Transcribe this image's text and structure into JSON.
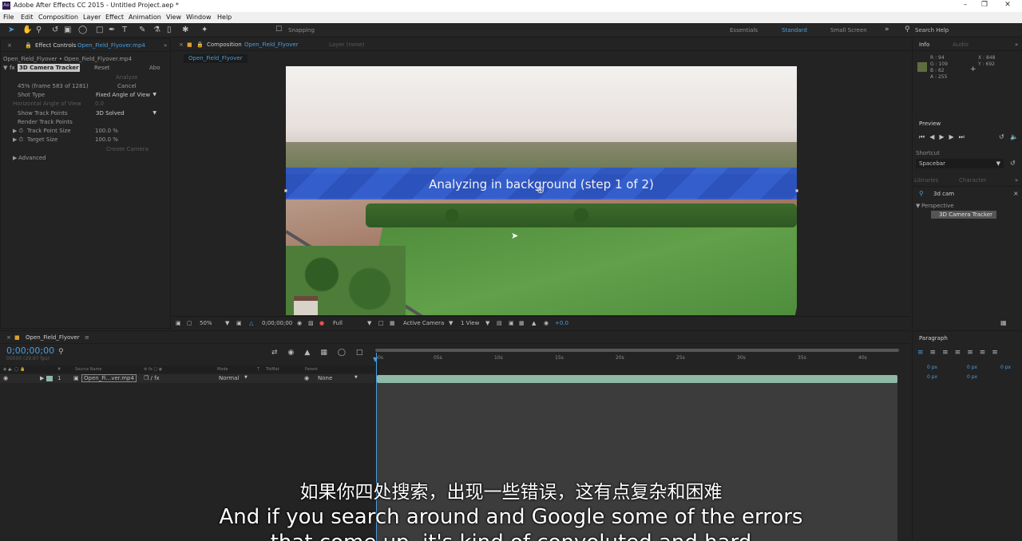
{
  "window": {
    "title": "Adobe After Effects CC 2015 - Untitled Project.aep *",
    "logo": "Ae"
  },
  "menu": [
    "File",
    "Edit",
    "Composition",
    "Layer",
    "Effect",
    "Animation",
    "View",
    "Window",
    "Help"
  ],
  "toolbar": {
    "snapping_label": "Snapping",
    "workspaces": [
      "Essentials",
      "Standard",
      "Small Screen"
    ],
    "search_placeholder": "Search Help"
  },
  "effect_controls": {
    "panel_label": "Effect Controls",
    "panel_file": "Open_Field_Flyover.mp4",
    "breadcrumb": "Open_Field_Flyover • Open_Field_Flyover.mp4",
    "effect_name": "3D Camera Tracker",
    "reset_label": "Reset",
    "about_label": "Abo",
    "analyze_label": "Analyze",
    "status_text": "45% (frame 583 of 1281)",
    "cancel_label": "Cancel",
    "shot_type_label": "Shot Type",
    "shot_type_value": "Fixed Angle of View",
    "horizontal_angle_label": "Horizontal Angle of View",
    "horizontal_angle_value": "0.0",
    "show_track_points_label": "Show Track Points",
    "show_track_points_value": "3D Solved",
    "render_track_points_label": "Render Track Points",
    "track_point_size_label": "Track Point Size",
    "track_point_size_value": "100.0 %",
    "target_size_label": "Target Size",
    "target_size_value": "100.0 %",
    "create_camera_label": "Create Camera",
    "advanced_label": "Advanced"
  },
  "composition": {
    "panel_label": "Composition",
    "comp_name": "Open_Field_Flyover",
    "layer_label": "Layer (none)",
    "tab_label": "Open_Field_Flyover",
    "banner_text": "Analyzing in background (step 1 of 2)",
    "zoom": "50%",
    "timecode": "0;00;00;00",
    "resolution": "Full",
    "camera": "Active Camera",
    "views": "1 View",
    "exposure": "+0.0"
  },
  "info_panel": {
    "tab_info": "Info",
    "tab_audio": "Audio",
    "r": "R : 94",
    "g": "G : 109",
    "b": "B : 62",
    "a": "A : 255",
    "x": "X : 848",
    "y": "Y : 692",
    "swatch_color": "#5e6d3e"
  },
  "preview_panel": {
    "title": "Preview",
    "shortcut_label": "Shortcut",
    "shortcut_value": "Spacebar"
  },
  "libraries_panel": {
    "tab_libraries": "Libraries",
    "tab_character": "Character",
    "search_value": "3d cam",
    "category": "Perspective",
    "result": "3D Camera Tracker"
  },
  "paragraph_panel": {
    "title": "Paragraph",
    "values": [
      "0 px",
      "0 px",
      "0 px",
      "0 px",
      "0 px"
    ]
  },
  "timeline": {
    "comp_tab": "Open_Field_Flyover",
    "timecode": "0;00;00;00",
    "fps": "00000 (29.97 fps)",
    "columns": {
      "source": "Source Name",
      "mode": "Mode",
      "t": "T",
      "trkmat": "TrkMat",
      "parent": "Parent"
    },
    "layer": {
      "index": "1",
      "name": "Open_Fi...ver.mp4",
      "mode": "Normal",
      "parent": "None"
    },
    "ruler": [
      "0s",
      "05s",
      "10s",
      "15s",
      "20s",
      "25s",
      "30s",
      "35s",
      "40s"
    ]
  },
  "subtitles": {
    "chinese": "如果你四处搜索，出现一些错误，这有点复杂和困难",
    "english": "And if you search around and Google some of the errors",
    "english_next": "that come up, it's kind of convoluted and hard"
  }
}
